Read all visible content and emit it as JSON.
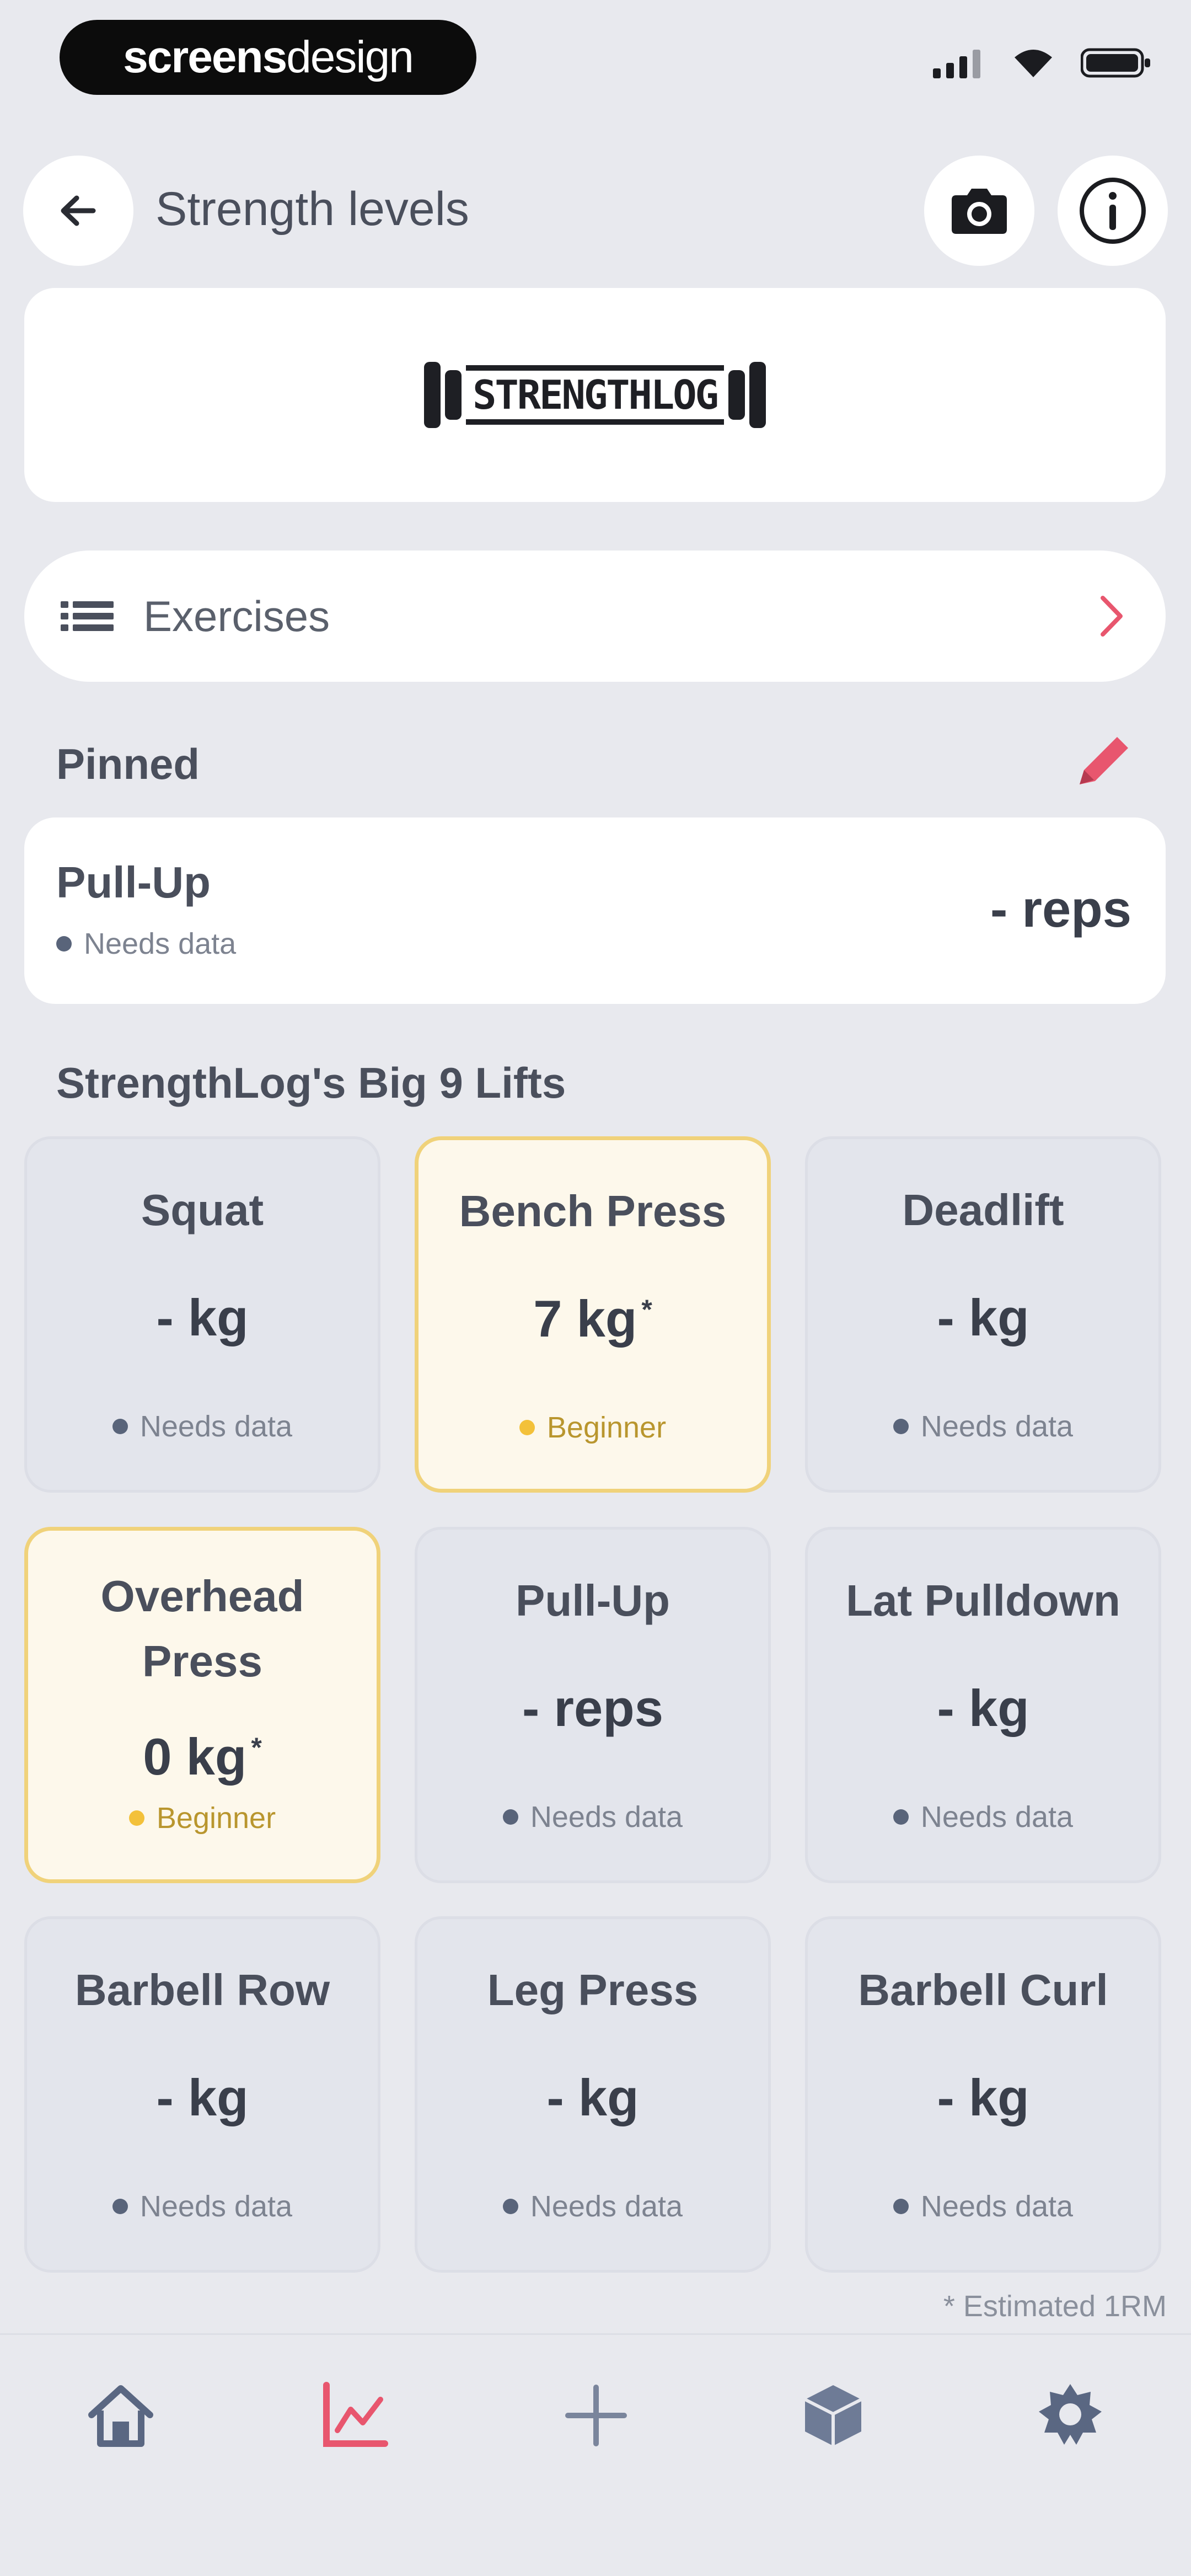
{
  "status": {
    "brand_bold": "screens",
    "brand_light": "design"
  },
  "header": {
    "title": "Strength levels"
  },
  "logo": {
    "text": "STRENGTHLOG"
  },
  "exercises_row": {
    "label": "Exercises"
  },
  "pinned": {
    "heading": "Pinned",
    "item": {
      "name": "Pull-Up",
      "status": "Needs data",
      "value": "- reps"
    }
  },
  "big9": {
    "heading": "StrengthLog's Big 9 Lifts",
    "tiles": [
      {
        "name": "Squat",
        "value": "- kg",
        "status": "Needs data"
      },
      {
        "name": "Bench Press",
        "value": "7 kg",
        "status": "Beginner"
      },
      {
        "name": "Deadlift",
        "value": "- kg",
        "status": "Needs data"
      },
      {
        "name": "Overhead Press",
        "value": "0 kg",
        "status": "Beginner"
      },
      {
        "name": "Pull-Up",
        "value": "- reps",
        "status": "Needs data"
      },
      {
        "name": "Lat Pulldown",
        "value": "- kg",
        "status": "Needs data"
      },
      {
        "name": "Barbell Row",
        "value": "- kg",
        "status": "Needs data"
      },
      {
        "name": "Leg Press",
        "value": "- kg",
        "status": "Needs data"
      },
      {
        "name": "Barbell Curl",
        "value": "- kg",
        "status": "Needs data"
      }
    ],
    "footnote": "* Estimated 1RM",
    "estimate_mark": "*"
  },
  "colors": {
    "accent": "#e8566e",
    "highlight_border": "#f0d27a",
    "highlight_bg": "#fdf8eb",
    "status_dot": "#59647a",
    "beginner_dot": "#f3c13a"
  }
}
